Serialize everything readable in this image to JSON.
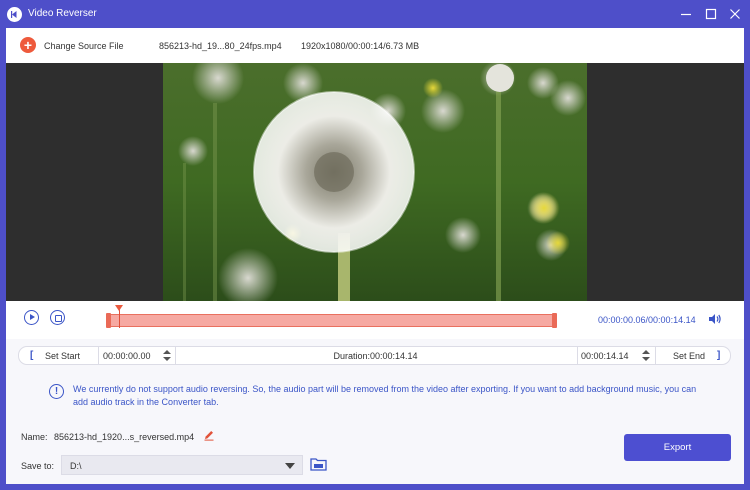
{
  "window": {
    "title": "Video Reverser"
  },
  "source": {
    "change_label": "Change Source File",
    "file_name": "856213-hd_19...80_24fps.mp4",
    "file_info": "1920x1080/00:00:14/6.73 MB"
  },
  "timeline": {
    "time_readout": "00:00:00.06/00:00:14.14",
    "progress": 0.004
  },
  "clip": {
    "set_start_label": "Set Start",
    "start_time": "00:00:00.00",
    "duration": "Duration:00:00:14.14",
    "end_time": "00:00:14.14",
    "set_end_label": "Set End"
  },
  "notice": {
    "icon": "info-icon",
    "text": "We currently do not support audio reversing. So, the audio part will be removed from the video after exporting. If you want to add background music, you can add audio track in the Converter tab."
  },
  "output": {
    "name_label": "Name:",
    "name_value": "856213-hd_1920...s_reversed.mp4",
    "save_label": "Save to:",
    "save_value": "D:\\",
    "export_label": "Export"
  },
  "colors": {
    "accent": "#4e4fc9",
    "link": "#3b55c7",
    "trim": "#ea6a57",
    "add": "#ee5a3c"
  }
}
